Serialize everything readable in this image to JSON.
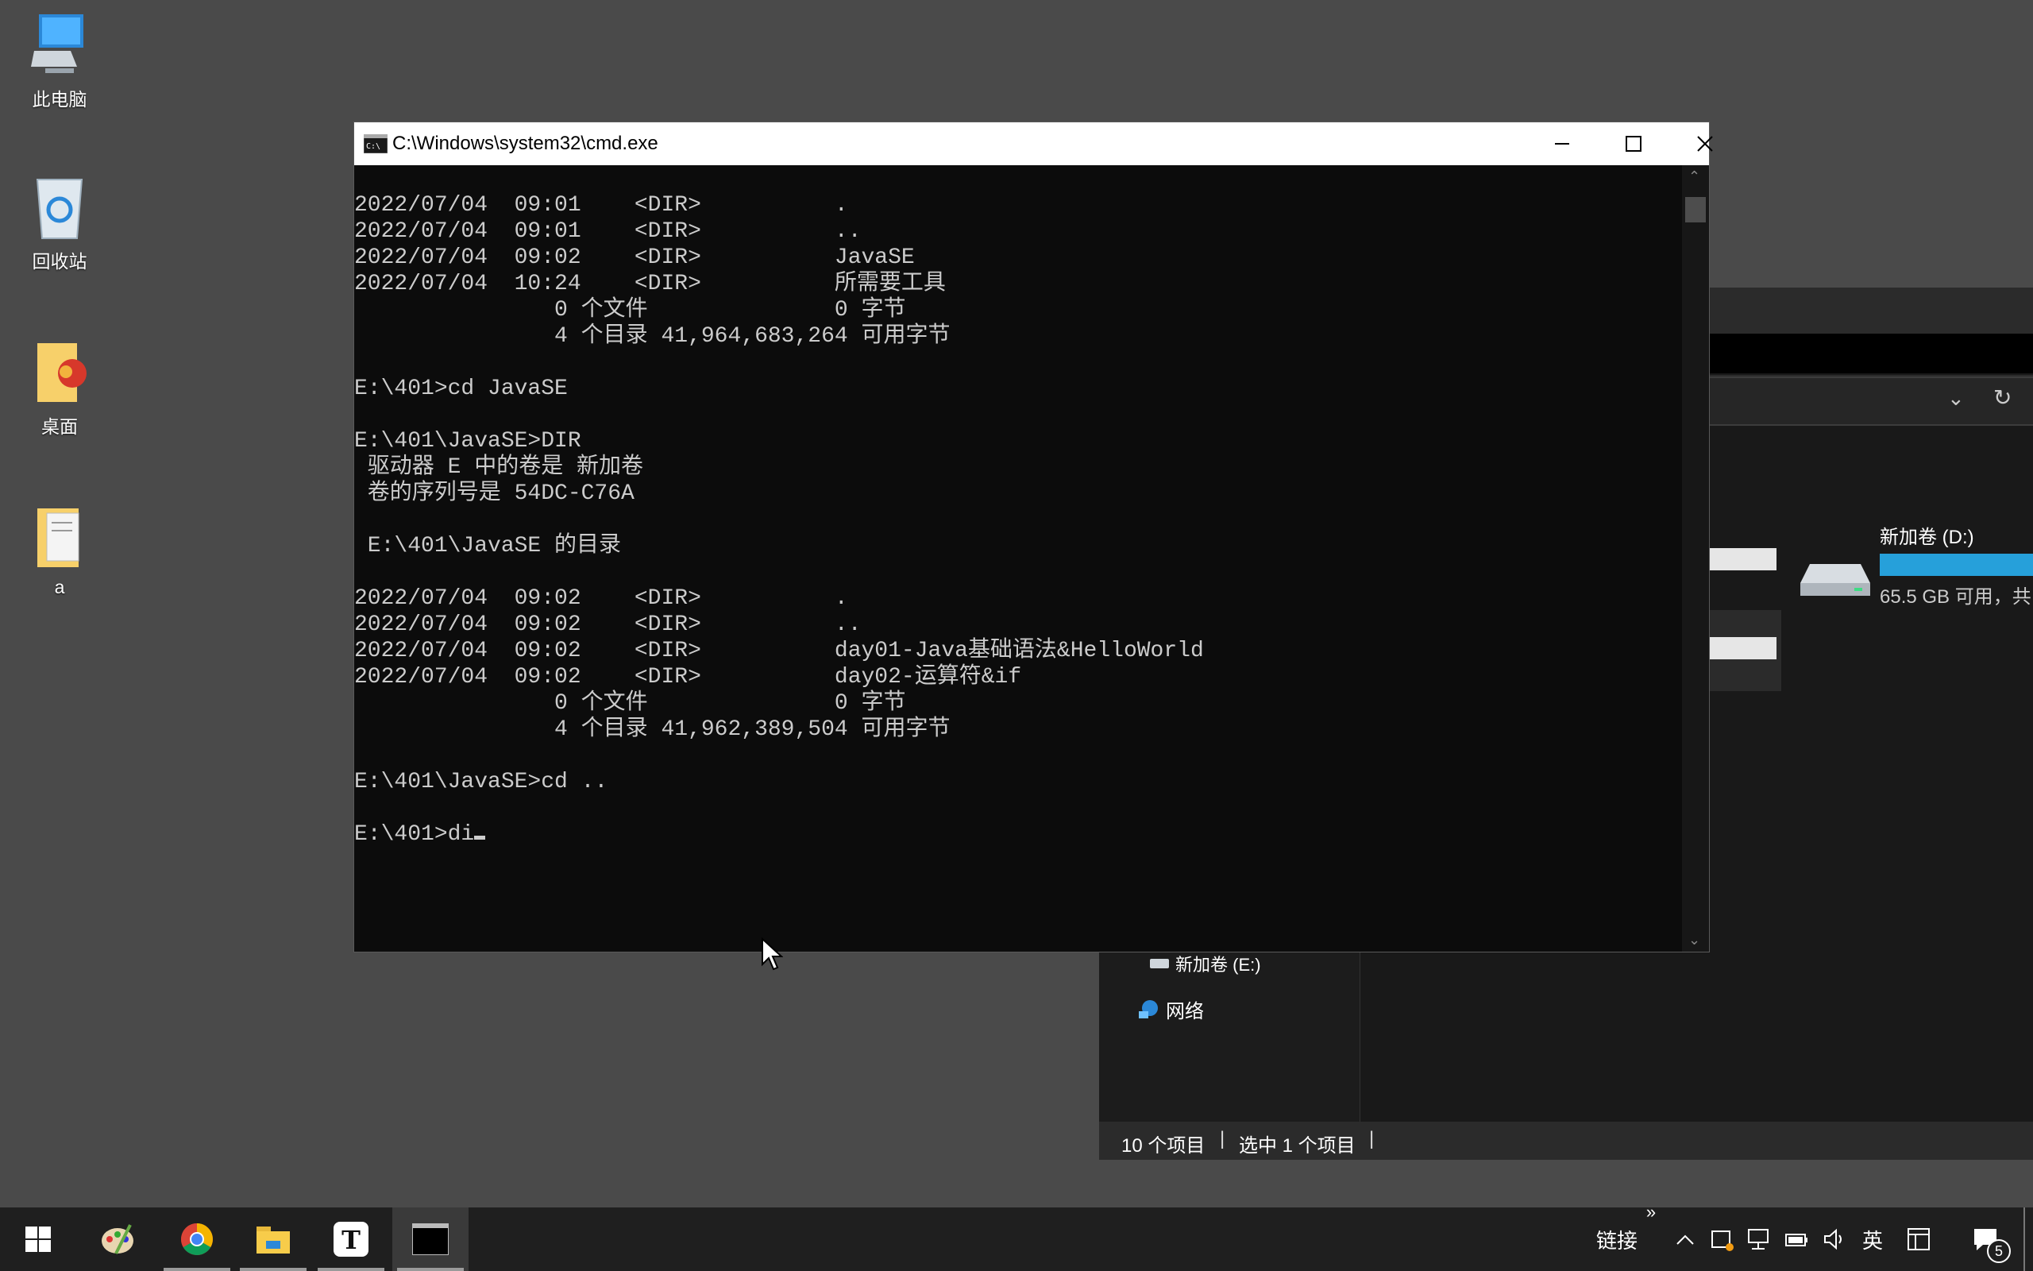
{
  "desktop": {
    "icons": [
      {
        "label": "此电脑",
        "icon": "computer-icon"
      },
      {
        "label": "回收站",
        "icon": "recycle-bin-icon"
      },
      {
        "label": "桌面",
        "icon": "folder-icon"
      },
      {
        "label": "a",
        "icon": "folder-icon"
      }
    ]
  },
  "cmd": {
    "title": "C:\\Windows\\system32\\cmd.exe",
    "lines": [
      "2022/07/04  09:01    <DIR>          .",
      "2022/07/04  09:01    <DIR>          ..",
      "2022/07/04  09:02    <DIR>          JavaSE",
      "2022/07/04  10:24    <DIR>          所需要工具",
      "               0 个文件              0 字节",
      "               4 个目录 41,964,683,264 可用字节",
      "",
      "E:\\401>cd JavaSE",
      "",
      "E:\\401\\JavaSE>DIR",
      " 驱动器 E 中的卷是 新加卷",
      " 卷的序列号是 54DC-C76A",
      "",
      " E:\\401\\JavaSE 的目录",
      "",
      "2022/07/04  09:02    <DIR>          .",
      "2022/07/04  09:02    <DIR>          ..",
      "2022/07/04  09:02    <DIR>          day01-Java基础语法&HelloWorld",
      "2022/07/04  09:02    <DIR>          day02-运算符&if",
      "               0 个文件              0 字节",
      "               4 个目录 41,962,389,504 可用字节",
      "",
      "E:\\401\\JavaSE>cd ..",
      "",
      "E:\\401>di"
    ]
  },
  "explorer": {
    "drive_d_name": "新加卷 (D:)",
    "drive_d_free": "65.5 GB 可用，共",
    "nav_drive_e": "新加卷 (E:)",
    "nav_network": "网络",
    "status_items": "10 个项目",
    "status_selected": "选中 1 个项目",
    "drive_d_used_fraction": 1.0
  },
  "taskbar": {
    "apps": [
      "start-icon",
      "paint-icon",
      "chrome-icon",
      "file-explorer-icon",
      "typora-icon",
      "cmd-icon"
    ],
    "links_label": "链接",
    "more_label": "»",
    "ime_label": "英",
    "notification_count": "5"
  }
}
